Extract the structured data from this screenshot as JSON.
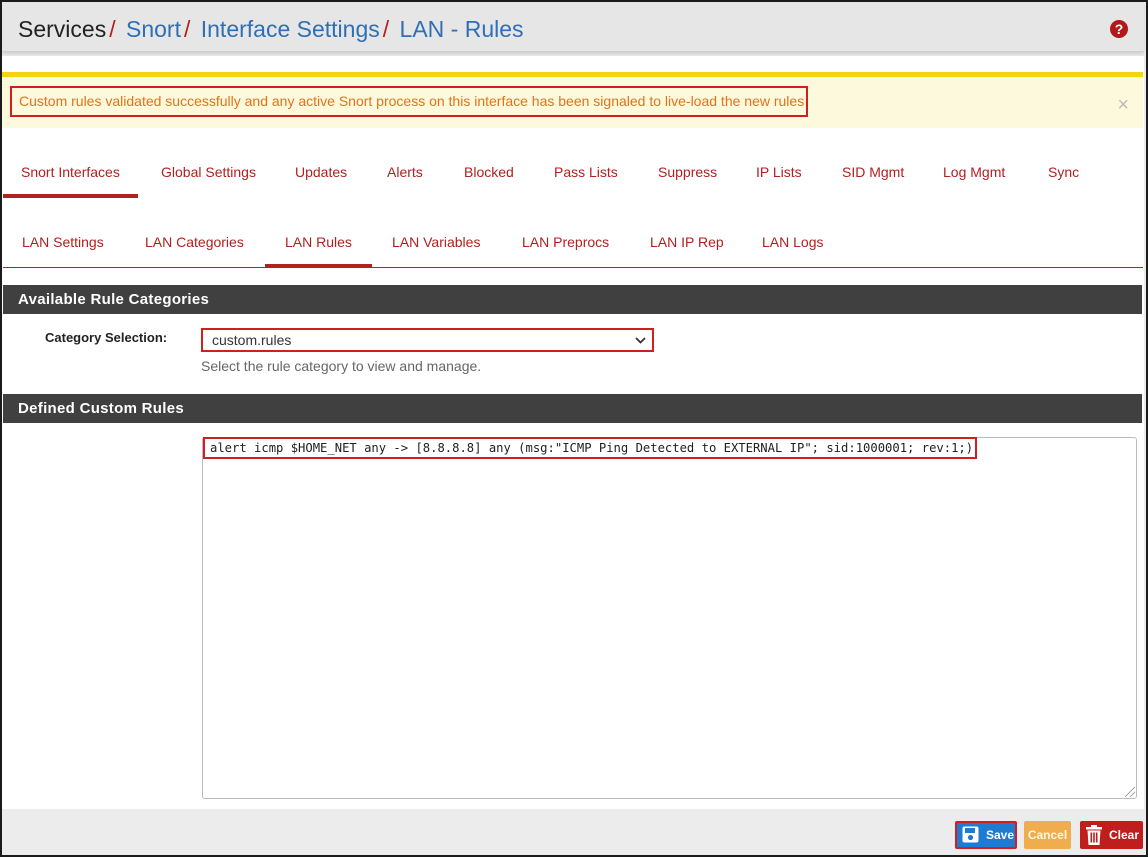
{
  "breadcrumb": {
    "root": "Services",
    "items": [
      "Snort",
      "Interface Settings",
      "LAN - Rules"
    ],
    "separator": "/"
  },
  "help_icon": "question-circle-icon",
  "alert": {
    "message": "Custom rules validated successfully and any active Snort process on this interface has been signaled to live-load the new rules",
    "close": "×"
  },
  "tabs_primary": [
    {
      "label": "Snort Interfaces",
      "active": true
    },
    {
      "label": "Global Settings"
    },
    {
      "label": "Updates"
    },
    {
      "label": "Alerts"
    },
    {
      "label": "Blocked"
    },
    {
      "label": "Pass Lists"
    },
    {
      "label": "Suppress"
    },
    {
      "label": "IP Lists"
    },
    {
      "label": "SID Mgmt"
    },
    {
      "label": "Log Mgmt"
    },
    {
      "label": "Sync"
    }
  ],
  "tabs_secondary": [
    {
      "label": "LAN Settings"
    },
    {
      "label": "LAN Categories"
    },
    {
      "label": "LAN Rules",
      "active": true
    },
    {
      "label": "LAN Variables"
    },
    {
      "label": "LAN Preprocs"
    },
    {
      "label": "LAN IP Rep"
    },
    {
      "label": "LAN Logs"
    }
  ],
  "categories_panel": {
    "title": "Available Rule Categories",
    "field_label": "Category Selection:",
    "selected": "custom.rules",
    "help": "Select the rule category to view and manage."
  },
  "custom_rules_panel": {
    "title": "Defined Custom Rules",
    "rule_text": "alert icmp $HOME_NET any -> [8.8.8.8] any (msg:\"ICMP Ping Detected to EXTERNAL IP\"; sid:1000001; rev:1;)"
  },
  "buttons": {
    "save": "Save",
    "cancel": "Cancel",
    "clear": "Clear"
  },
  "colors": {
    "accent_red": "#b0211f",
    "link_blue": "#2f6fb5",
    "panel_heading": "#404040",
    "alert_bg": "#fdf9dc",
    "alert_text": "#e0731b",
    "save_blue": "#1e7bd0",
    "cancel_orange": "#f0ad4e",
    "clear_red": "#c01d1d"
  }
}
